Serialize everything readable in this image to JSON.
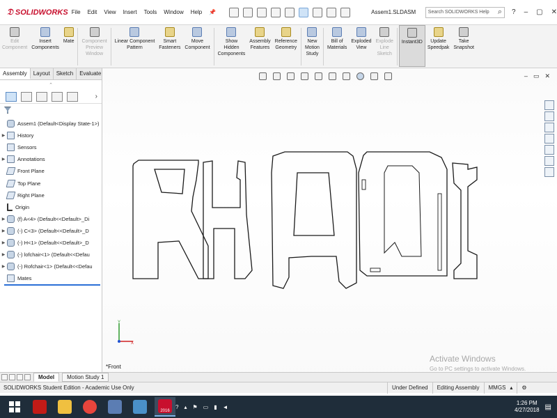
{
  "app": {
    "logo_text": "SOLIDWORKS",
    "document_title": "Assem1.SLDASM",
    "menu": [
      "File",
      "Edit",
      "View",
      "Insert",
      "Tools",
      "Window",
      "Help"
    ],
    "search_placeholder": "Search SOLIDWORKS Help",
    "help_label": "?"
  },
  "commands": [
    {
      "label": "Edit\nComponent",
      "disabled": true
    },
    {
      "label": "Insert\nComponents",
      "disabled": false
    },
    {
      "label": "Mate",
      "disabled": false
    },
    {
      "label": "Component\nPreview\nWindow",
      "disabled": true
    },
    {
      "label": "Linear Component\nPattern",
      "disabled": false
    },
    {
      "label": "Smart\nFasteners",
      "disabled": false
    },
    {
      "label": "Move\nComponent",
      "disabled": false
    },
    {
      "label": "Show\nHidden\nComponents",
      "disabled": false
    },
    {
      "label": "Assembly\nFeatures",
      "disabled": false
    },
    {
      "label": "Reference\nGeometry",
      "disabled": false
    },
    {
      "label": "New\nMotion\nStudy",
      "disabled": false
    },
    {
      "label": "Bill of\nMaterials",
      "disabled": false
    },
    {
      "label": "Exploded\nView",
      "disabled": false
    },
    {
      "label": "Explode\nLine\nSketch",
      "disabled": true
    },
    {
      "label": "Instant3D",
      "disabled": false,
      "active": true
    },
    {
      "label": "Update\nSpeedpak",
      "disabled": false
    },
    {
      "label": "Take\nSnapshot",
      "disabled": false
    }
  ],
  "panel": {
    "tabs": [
      "Assembly",
      "Layout",
      "Sketch",
      "Evaluate"
    ],
    "active_tab": "Assembly",
    "tree": [
      {
        "label": "Assem1  (Default<Display State-1>)",
        "icon": "assembly-icon",
        "expandable": false
      },
      {
        "label": "History",
        "icon": "history-icon",
        "expandable": true
      },
      {
        "label": "Sensors",
        "icon": "sensors-icon",
        "expandable": false
      },
      {
        "label": "Annotations",
        "icon": "annotations-icon",
        "expandable": true
      },
      {
        "label": "Front Plane",
        "icon": "plane-icon",
        "expandable": false
      },
      {
        "label": "Top Plane",
        "icon": "plane-icon",
        "expandable": false
      },
      {
        "label": "Right Plane",
        "icon": "plane-icon",
        "expandable": false
      },
      {
        "label": "Origin",
        "icon": "origin-icon",
        "expandable": false
      },
      {
        "label": "(f) A<4> (Default<<Default>_Di",
        "icon": "part-icon",
        "expandable": true
      },
      {
        "label": "(-) C<3> (Default<<Default>_D",
        "icon": "part-icon",
        "expandable": true
      },
      {
        "label": "(-) H<1> (Default<<Default>_D",
        "icon": "part-icon",
        "expandable": true
      },
      {
        "label": "(-) lofchair<1> (Default<<Defau",
        "icon": "part-icon",
        "expandable": true
      },
      {
        "label": "(-) Rofchair<1> (Default<<Defau",
        "icon": "part-icon",
        "expandable": true
      },
      {
        "label": "Mates",
        "icon": "mates-icon",
        "expandable": false
      }
    ]
  },
  "viewport": {
    "view_label": "*Front",
    "watermark_title": "Activate Windows",
    "watermark_sub": "Go to PC settings to activate Windows."
  },
  "model_tabs": [
    "Model",
    "Motion Study 1"
  ],
  "status": {
    "edition": "SOLIDWORKS Student Edition - Academic Use Only",
    "state": "Under Defined",
    "mode": "Editing Assembly",
    "units": "MMGS"
  },
  "taskbar": {
    "time": "1:26 PM",
    "date": "4/27/2018",
    "sw_badge": "2016"
  },
  "colors": {
    "accent": "#2a6fd6",
    "brand_red": "#c8102e",
    "taskbar": "#1f2d3a"
  }
}
